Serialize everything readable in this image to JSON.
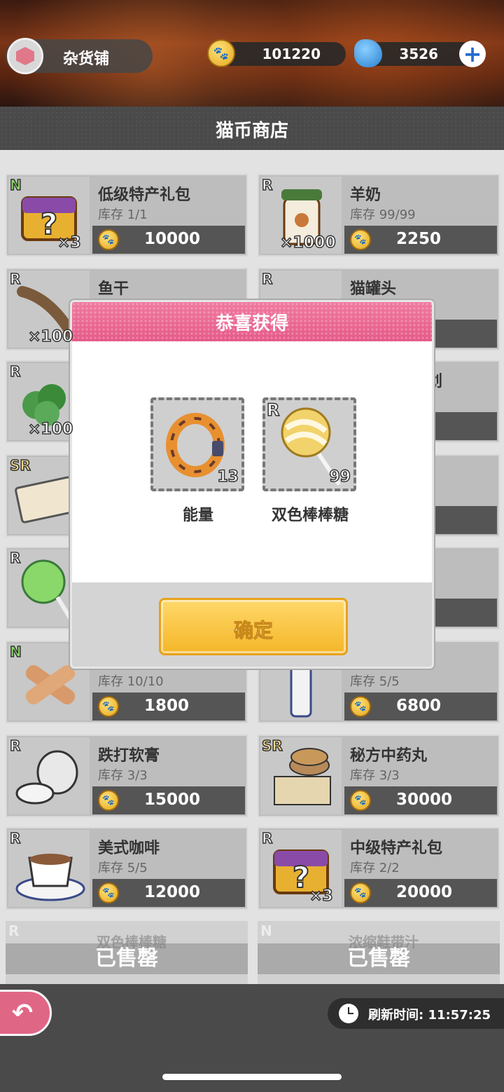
{
  "header": {
    "shop_label": "杂货铺",
    "coins": "101220",
    "fish": "3526"
  },
  "section_title": "猫币商店",
  "items": [
    {
      "rarity": "N",
      "qty": "×3",
      "name": "低级特产礼包",
      "stock": "库存 1/1",
      "price": "10000"
    },
    {
      "rarity": "R",
      "qty": "×1000",
      "name": "羊奶",
      "stock": "库存 99/99",
      "price": "2250"
    },
    {
      "rarity": "R",
      "qty": "×100",
      "name": "鱼干",
      "stock": "",
      "price": ""
    },
    {
      "rarity": "R",
      "qty": "",
      "name": "猫罐头",
      "stock": "",
      "price": ""
    },
    {
      "rarity": "R",
      "qty": "×100",
      "name": "",
      "stock": "",
      "price": ""
    },
    {
      "rarity": "",
      "qty": "",
      "name": "划",
      "stock": "",
      "price": ""
    },
    {
      "rarity": "SR",
      "qty": "",
      "name": "",
      "stock": "",
      "price": ""
    },
    {
      "rarity": "",
      "qty": "",
      "name": "",
      "stock": "",
      "price": ""
    },
    {
      "rarity": "R",
      "qty": "",
      "name": "",
      "stock": "",
      "price": ""
    },
    {
      "rarity": "",
      "qty": "",
      "name": "",
      "stock": "",
      "price": ""
    },
    {
      "rarity": "N",
      "qty": "",
      "name": "",
      "stock": "库存 10/10",
      "price": "1800"
    },
    {
      "rarity": "",
      "qty": "",
      "name": "",
      "stock": "库存 5/5",
      "price": "6800"
    },
    {
      "rarity": "R",
      "qty": "",
      "name": "跌打软膏",
      "stock": "库存 3/3",
      "price": "15000"
    },
    {
      "rarity": "SR",
      "qty": "",
      "name": "秘方中药丸",
      "stock": "库存 3/3",
      "price": "30000"
    },
    {
      "rarity": "R",
      "qty": "",
      "name": "美式咖啡",
      "stock": "库存 5/5",
      "price": "12000"
    },
    {
      "rarity": "R",
      "qty": "×3",
      "name": "中级特产礼包",
      "stock": "库存 2/2",
      "price": "20000"
    }
  ],
  "sold_items": [
    {
      "rarity": "R",
      "name": "双色棒棒糖",
      "sold_label": "已售罄"
    },
    {
      "rarity": "N",
      "name": "浓缩鞋带汁",
      "sold_label": "已售罄"
    }
  ],
  "modal": {
    "title": "恭喜获得",
    "rewards": [
      {
        "rarity": "",
        "qty": "13",
        "name": "能量",
        "icon": "energy-ring-icon"
      },
      {
        "rarity": "R",
        "qty": "99",
        "name": "双色棒棒糖",
        "icon": "lollipop-icon"
      }
    ],
    "confirm_label": "确定"
  },
  "footer": {
    "refresh_label": "刷新时间:  11:57:25"
  },
  "colors": {
    "accent_pink": "#e55a88",
    "confirm_yellow": "#f4b628"
  }
}
